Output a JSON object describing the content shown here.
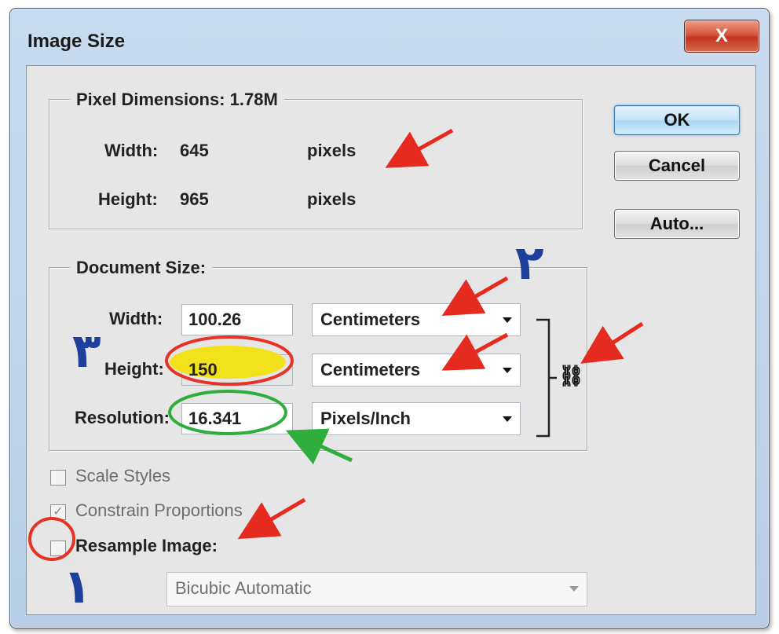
{
  "window": {
    "title": "Image Size",
    "close_label": "X"
  },
  "pixel_dimensions": {
    "legend": "Pixel Dimensions:",
    "size": "1.78M",
    "width_label": "Width:",
    "width_value": "645",
    "width_unit": "pixels",
    "height_label": "Height:",
    "height_value": "965",
    "height_unit": "pixels"
  },
  "document_size": {
    "legend": "Document Size:",
    "width_label": "Width:",
    "width_value": "100.26",
    "width_unit": "Centimeters",
    "height_label": "Height:",
    "height_value": "150",
    "height_unit": "Centimeters",
    "resolution_label": "Resolution:",
    "resolution_value": "16.341",
    "resolution_unit": "Pixels/Inch"
  },
  "buttons": {
    "ok": "OK",
    "cancel": "Cancel",
    "auto": "Auto..."
  },
  "options": {
    "scale_styles": "Scale Styles",
    "scale_styles_checked": false,
    "constrain_proportions": "Constrain Proportions",
    "constrain_proportions_checked": true,
    "resample_image": "Resample Image:",
    "resample_image_checked": false,
    "resample_method": "Bicubic Automatic"
  },
  "annotations": {
    "marker_1": "١",
    "marker_2": "٢",
    "marker_3": "٣",
    "arrow_color_red": "#e52b1f",
    "arrow_color_green": "#2fae3d",
    "circle_color_red": "#e53325",
    "circle_color_green": "#2fae3d",
    "highlight_color": "#f2e21b",
    "marker_color": "#1f3f9c"
  }
}
